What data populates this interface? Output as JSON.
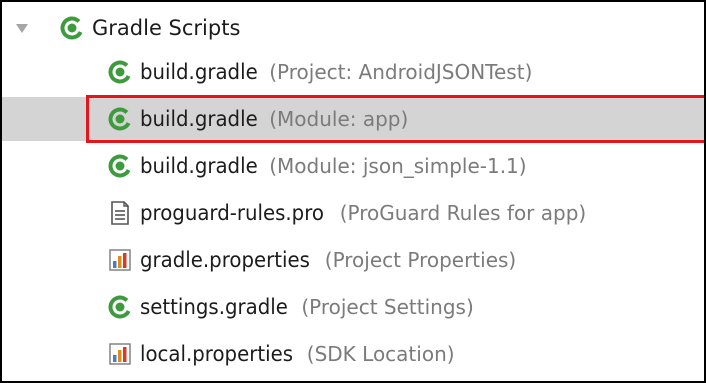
{
  "tree": {
    "group_label": "Gradle Scripts",
    "group_icon": "gradle-icon",
    "expand_icon": "expanded-arrow-icon",
    "items": [
      {
        "name": "build.gradle",
        "hint": "(Project: AndroidJSONTest)",
        "icon": "gradle-icon",
        "selected": false
      },
      {
        "name": "build.gradle",
        "hint": "(Module: app)",
        "icon": "gradle-icon",
        "selected": true
      },
      {
        "name": "build.gradle",
        "hint": "(Module: json_simple-1.1)",
        "icon": "gradle-icon",
        "selected": false
      },
      {
        "name": "proguard-rules.pro",
        "hint": "(ProGuard Rules for app)",
        "icon": "text-file-icon",
        "selected": false
      },
      {
        "name": "gradle.properties",
        "hint": "(Project Properties)",
        "icon": "properties-file-icon",
        "selected": false
      },
      {
        "name": "settings.gradle",
        "hint": "(Project Settings)",
        "icon": "gradle-icon",
        "selected": false
      },
      {
        "name": "local.properties",
        "hint": "(SDK Location)",
        "icon": "properties-file-icon",
        "selected": false
      }
    ]
  },
  "colors": {
    "gradle_green": "#3d9b3d",
    "selection_bg": "#d4d4d4",
    "highlight_red": "#e3141a",
    "hint_text": "#7b7b7b"
  }
}
